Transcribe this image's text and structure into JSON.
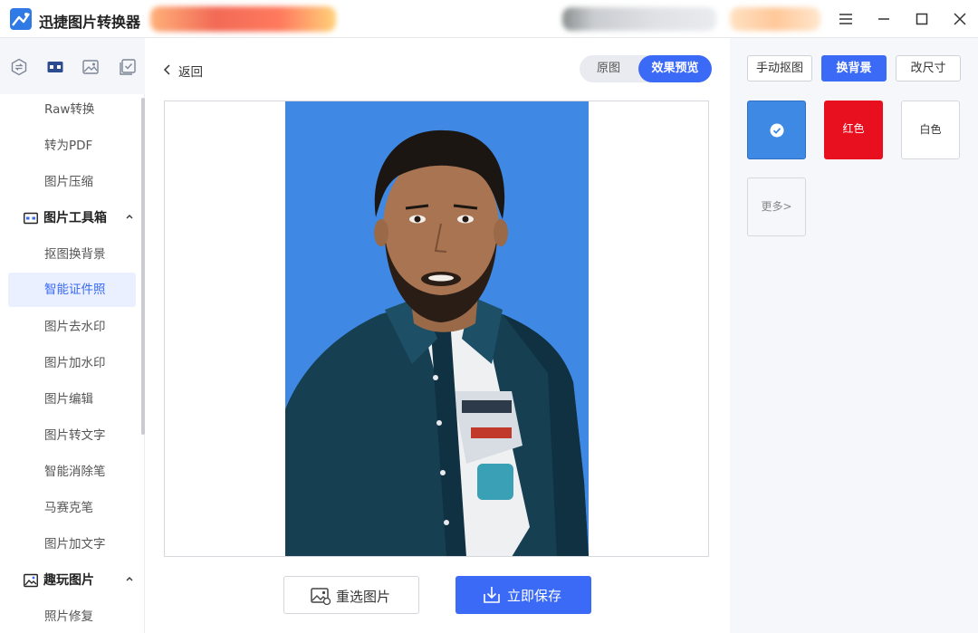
{
  "app": {
    "title": "迅捷图片转换器"
  },
  "window_controls": [
    "menu-icon",
    "minimize-icon",
    "maximize-icon",
    "close-icon"
  ],
  "sidebar": {
    "top_icons": [
      "convert-icon",
      "toolbox-icon",
      "image-edit-icon",
      "checklist-icon"
    ],
    "items_top": [
      {
        "label": "Raw转换"
      },
      {
        "label": "转为PDF"
      },
      {
        "label": "图片压缩"
      }
    ],
    "category_toolbox": {
      "label": "图片工具箱",
      "icon": "toolbox-icon",
      "expanded": true
    },
    "toolbox_items": [
      {
        "label": "抠图换背景"
      },
      {
        "label": "智能证件照",
        "active": true
      },
      {
        "label": "图片去水印"
      },
      {
        "label": "图片加水印"
      },
      {
        "label": "图片编辑"
      },
      {
        "label": "图片转文字"
      },
      {
        "label": "智能消除笔"
      },
      {
        "label": "马赛克笔"
      },
      {
        "label": "图片加文字"
      }
    ],
    "category_fun": {
      "label": "趣玩图片",
      "icon": "image-fun-icon",
      "expanded": true
    },
    "fun_items": [
      {
        "label": "照片修复"
      }
    ]
  },
  "main": {
    "back_label": "返回",
    "view_toggle": {
      "original": "原图",
      "preview": "效果预览",
      "selected": "preview"
    },
    "reselect_label": "重选图片",
    "save_label": "立即保存"
  },
  "right_panel": {
    "tabs": {
      "manual_cutout": "手动抠图",
      "change_background": "换背景",
      "resize": "改尺寸",
      "selected": "change_background"
    },
    "background_colors": [
      {
        "label": "",
        "color": "#3e89e4",
        "selected": true
      },
      {
        "label": "红色",
        "color": "#e8101f",
        "selected": false
      },
      {
        "label": "白色",
        "color": "#ffffff",
        "selected": false
      }
    ],
    "more_label": "更多>"
  },
  "colors": {
    "accent": "#3b6af6",
    "photo_background": "#3f89e4"
  }
}
